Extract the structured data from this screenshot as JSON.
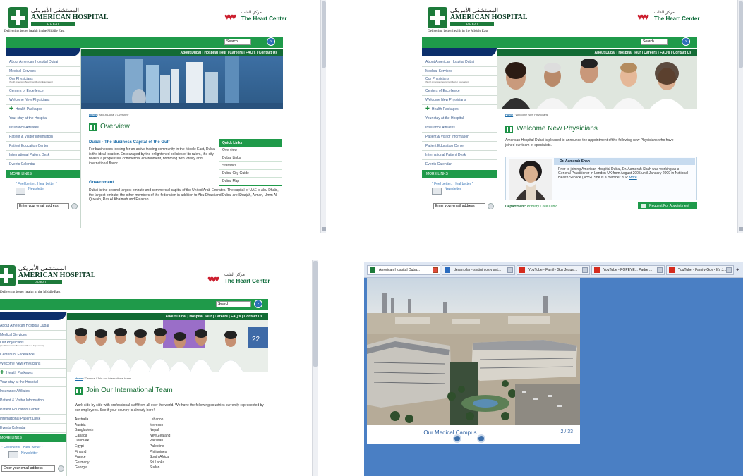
{
  "quick_links": [
    "Overview",
    "Dubai Links",
    "Statistics",
    "Dubai City Guide",
    "Dubai Map"
  ],
  "site": {
    "logo_arabic": "المستشفى الأمريكي",
    "logo_name": "AMERICAN HOSPITAL",
    "logo_sub": "D U B A I",
    "tagline": "Delivering better health in the Middle East",
    "heart_arabic": "مركز القلب",
    "heart_center": "The Heart Center",
    "search_label": "Search",
    "top_nav": "About Dubai | Hospital Tour | Careers | FAQ's | Contact Us",
    "nav": [
      {
        "label": "About American Hospital Dubai"
      },
      {
        "label": "Medical Services"
      },
      {
        "label": "Our Physicians",
        "sub": "(North American Board Certified or Equivalent)"
      },
      {
        "label": "Centers of Excellence"
      },
      {
        "label": "Welcome New Physicians"
      },
      {
        "label": "Health Packages"
      },
      {
        "label": "Your stay at the Hospital"
      },
      {
        "label": "Insurance Affiliates"
      },
      {
        "label": "Patient & Visitor Information"
      },
      {
        "label": "Patient Education Center"
      },
      {
        "label": "International Patient Desk"
      },
      {
        "label": "Events Calendar"
      }
    ],
    "more_links": "MORE LINKS",
    "feel_better": "\" Feel better.. Heal better \"",
    "feel_better_alt": "\" Feel better.. Heal better \"",
    "newsletter": "Newsletter",
    "email_placeholder": "Enter your email address"
  },
  "page1": {
    "breadcrumb_home": "Home",
    "breadcrumb_rest": "/ About Dubai / Overview",
    "title": "Overview",
    "heading": "Dubai - The Business Capital of the Gulf",
    "paragraph1": "For businesses looking for an active trading community in the Middle East, Dubai is the ideal location. Encouraged by the enlightened policies of its rulers, the city boasts a progressive commercial environment, brimming with vitality and international flavor.",
    "heading2": "Government",
    "paragraph2": "Dubai is the second largest emirate and commercial capital of the United Arab Emirates. The capital of UAE is Abu Dhabi, the largest emirate; the other members of the federation in addition to Abu Dhabi and Dubai are Sharjah, Ajman, Umm Al Quwain, Ras Al Khaimah and Fujairah.",
    "quick_links_title": "Quick Links"
  },
  "page2": {
    "breadcrumb_home": "Home",
    "breadcrumb_rest": "/ Welcome New Physicians",
    "title": "Welcome New Physicians",
    "intro": "American Hospital Dubai is pleased to announce the appointment of the following new Physicians who have joined our team of specialists.",
    "doctor_name": "Dr. Aamerah Shah",
    "doctor_text": "Prior to joining American Hospital Dubai, Dr. Aamerah Shah was working as a General Practitioner in London UK from August 2005 until January 2009 in National Health Service (NHS). She is a member of R",
    "more": "More",
    "dept_label": "Department:",
    "dept_value": "Primary Care Clinic",
    "appointment_button": "Request For Appointment"
  },
  "page3": {
    "breadcrumb_home": "Home",
    "breadcrumb_rest": "/ Careers / Join our international team",
    "title": "Join Our International Team",
    "intro": "Work side by side with professional staff from all over the world. We have the following countries currently represented by our employees. See if your country is already here!",
    "countries_col1": [
      "Australia",
      "Austria",
      "Bangladesh",
      "Canada",
      "Denmark",
      "Egypt",
      "Finland",
      "France",
      "Germany",
      "Georgia"
    ],
    "countries_col2": [
      "Lebanon",
      "Morocco",
      "Nepal",
      "New Zealand",
      "Pakistan",
      "Palestine",
      "Philippines",
      "South Africa",
      "Sri Lanka",
      "Sudan"
    ]
  },
  "browser": {
    "tabs": [
      {
        "label": "American Hospital Duba..."
      },
      {
        "label": "desarrollar - sinónimos y ant..."
      },
      {
        "label": "YouTube - Family Guy Jesus ..."
      },
      {
        "label": "YouTube - POPEYE... Padre ..."
      },
      {
        "label": "YouTube - Family Guy - It's J..."
      }
    ],
    "caption": "Our Medical Campus",
    "counter": "2 / 33"
  }
}
